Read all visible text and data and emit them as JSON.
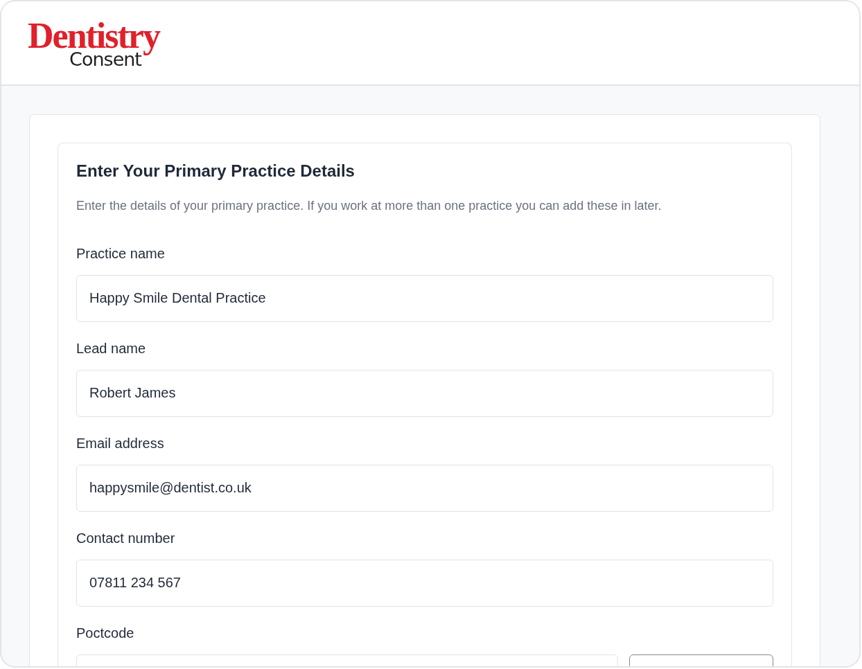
{
  "logo": {
    "brand": "Dentistry",
    "product": "Consent"
  },
  "form": {
    "title": "Enter Your Primary Practice Details",
    "description": "Enter the details of your primary practice. If you work at more than one practice you can add these in later.",
    "fields": [
      {
        "kind": "text",
        "label": "Practice name",
        "value": "Happy Smile Dental Practice"
      },
      {
        "kind": "text",
        "label": "Lead name",
        "value": "Robert James"
      },
      {
        "kind": "text",
        "label": "Email address",
        "value": "happysmile@dentist.co.uk"
      },
      {
        "kind": "text",
        "label": "Contact number",
        "value": "07811 234 567"
      },
      {
        "kind": "lookup",
        "label": "Poctcode"
      }
    ]
  }
}
